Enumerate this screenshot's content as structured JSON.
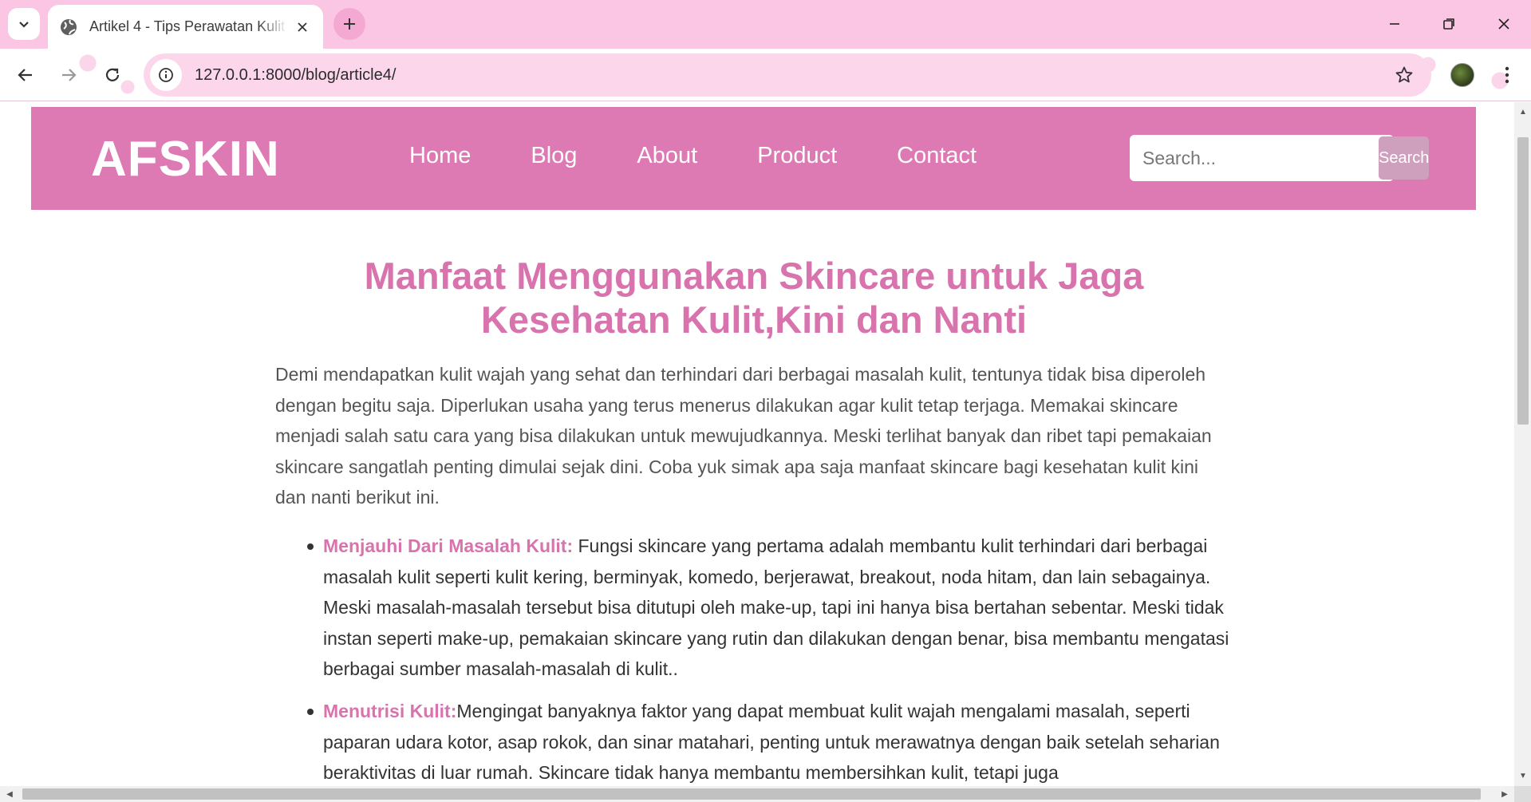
{
  "browser": {
    "tab_title": "Artikel 4 - Tips Perawatan Kulit",
    "url": "127.0.0.1:8000/blog/article4/"
  },
  "site": {
    "logo": "AFSKIN",
    "nav": [
      "Home",
      "Blog",
      "About",
      "Product",
      "Contact"
    ],
    "search_placeholder": "Search...",
    "search_button": "Search"
  },
  "article": {
    "title": "Manfaat Menggunakan Skincare untuk Jaga Kesehatan Kulit,Kini dan Nanti",
    "intro": "Demi mendapatkan kulit wajah yang sehat dan terhindari dari berbagai masalah kulit, tentunya tidak bisa diperoleh dengan begitu saja. Diperlukan usaha yang terus menerus dilakukan agar kulit tetap terjaga. Memakai skincare menjadi salah satu cara yang bisa dilakukan untuk mewujudkannya. Meski terlihat banyak dan ribet tapi pemakaian skincare sangatlah penting dimulai sejak dini. Coba yuk simak apa saja manfaat skincare bagi kesehatan kulit kini dan nanti berikut ini.",
    "points": [
      {
        "label": "Menjauhi Dari Masalah Kulit:",
        "text": " Fungsi skincare yang pertama adalah membantu kulit terhindari dari berbagai masalah kulit seperti kulit kering, berminyak, komedo, berjerawat, breakout, noda hitam, dan lain sebagainya. Meski masalah-masalah tersebut bisa ditutupi oleh make-up, tapi ini hanya bisa bertahan sebentar. Meski tidak instan seperti make-up, pemakaian skincare yang rutin dan dilakukan dengan benar, bisa membantu mengatasi berbagai sumber masalah-masalah di kulit.."
      },
      {
        "label": "Menutrisi Kulit:",
        "text": "Mengingat banyaknya faktor yang dapat membuat kulit wajah mengalami masalah, seperti paparan udara kotor, asap rokok, dan sinar matahari, penting untuk merawatnya dengan baik setelah seharian beraktivitas di luar rumah. Skincare tidak hanya membantu membersihkan kulit, tetapi juga"
      }
    ]
  },
  "colors": {
    "tabbar": "#fbc6e4",
    "header": "#de7ab3",
    "accent": "#d873ad",
    "search_button": "#cfa0bd"
  }
}
